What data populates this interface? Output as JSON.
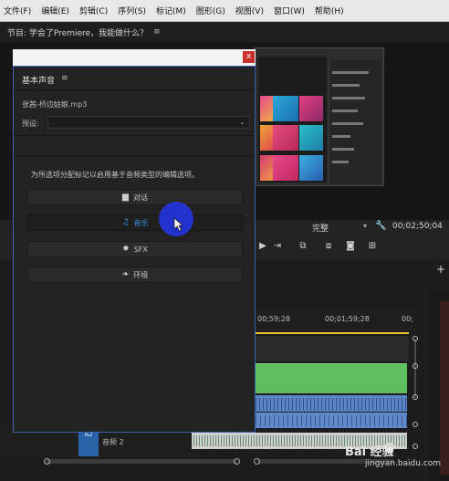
{
  "menu": {
    "items": [
      "文件(F)",
      "编辑(E)",
      "剪辑(C)",
      "序列(S)",
      "标记(M)",
      "图形(G)",
      "视图(V)",
      "窗口(W)",
      "帮助(H)"
    ]
  },
  "program_monitor": {
    "title": "节目: 学会了Premiere，我能做什么？",
    "quality": "完整",
    "timecode": "00;02;50;04"
  },
  "timeline": {
    "ruler": [
      "00;59;28",
      "00;01;59;28",
      "00;"
    ],
    "track_badge": "A2",
    "track_label": "音频 2"
  },
  "essential_sound": {
    "title": "基本声音",
    "clip_name": "张茜-桥边姑娘.mp3",
    "preset_label": "预设:",
    "instruction": "为所选项分配标记以启用基于音频类型的编辑选项。",
    "types": [
      {
        "label": "对话",
        "icon": "speech-bubble-icon",
        "active": false
      },
      {
        "label": "音乐",
        "icon": "music-note-icon",
        "active": true
      },
      {
        "label": "SFX",
        "icon": "burst-icon",
        "active": false
      },
      {
        "label": "环境",
        "icon": "leaf-icon",
        "active": false
      }
    ]
  },
  "watermark": {
    "brand": "Bai 经验",
    "site": "jingyan.baidu.com"
  },
  "colors": {
    "accent": "#3f8ee6",
    "panel_border": "#3a63b5",
    "close": "#c9302c",
    "clip_green": "#5fbf5f",
    "clip_blue": "#5a86c8",
    "playhead_yellow": "#e7c630",
    "cursor_highlight": "#2434e6"
  }
}
